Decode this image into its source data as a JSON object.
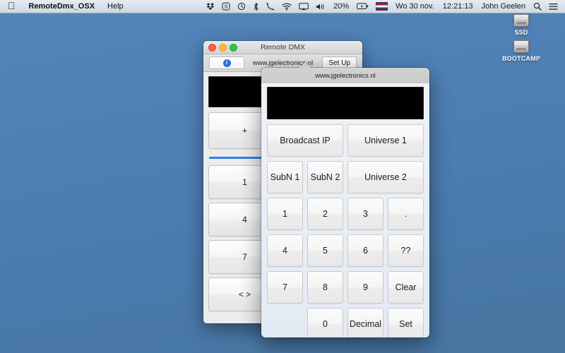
{
  "menubar": {
    "apple_icon": "apple-logo-icon",
    "app_name": "RemoteDmx_OSX",
    "menus": [
      "Help"
    ],
    "status_icons": [
      {
        "name": "dropbox-icon",
        "label": ""
      },
      {
        "name": "circled-s-icon",
        "label": ""
      },
      {
        "name": "clock-icon",
        "label": ""
      },
      {
        "name": "bluetooth-icon",
        "label": ""
      },
      {
        "name": "telephone-handset-icon",
        "label": ""
      },
      {
        "name": "wifi-icon",
        "label": ""
      },
      {
        "name": "airplay-display-icon",
        "label": ""
      },
      {
        "name": "volume-icon",
        "label": ""
      }
    ],
    "battery_percent": "20%",
    "battery_icon": "battery-charging-icon",
    "flag": "netherlands-flag-icon",
    "date": "Wo 30 nov.",
    "time": "12:21:13",
    "user": "John Geelen",
    "search_icon": "search-icon",
    "notification_icon": "notification-center-icon"
  },
  "desktop": {
    "icons": [
      {
        "label": "SSD",
        "glyph": "hard-drive-icon"
      },
      {
        "label": "BOOTCAMP",
        "glyph": "hard-drive-icon"
      }
    ]
  },
  "remote_dmx_window": {
    "title": "Remote DMX",
    "traffic_lights": [
      "close",
      "minimize",
      "maximize"
    ],
    "info_button": "i",
    "url": "www.jgelectronics.nl",
    "setup_button": "Set Up",
    "display_value": "",
    "top_buttons": [
      "+",
      ""
    ],
    "keypad_buttons": [
      "1",
      "",
      "4",
      "",
      "7",
      "",
      "< >",
      ""
    ]
  },
  "setup_panel": {
    "title": "www.jgelectronics.nl",
    "display_value": "",
    "buttons": [
      {
        "label": "Broadcast IP",
        "wide": true
      },
      {
        "label": "Universe 1",
        "wide": true
      },
      {
        "label": "SubN 1",
        "wide": false
      },
      {
        "label": "SubN 2",
        "wide": false
      },
      {
        "label": "Universe 2",
        "wide": true
      },
      {
        "label": "1",
        "wide": false
      },
      {
        "label": "2",
        "wide": false
      },
      {
        "label": "3",
        "wide": false
      },
      {
        "label": ".",
        "wide": false
      },
      {
        "label": "4",
        "wide": false
      },
      {
        "label": "5",
        "wide": false
      },
      {
        "label": "6",
        "wide": false
      },
      {
        "label": "??",
        "wide": false
      },
      {
        "label": "7",
        "wide": false
      },
      {
        "label": "8",
        "wide": false
      },
      {
        "label": "9",
        "wide": false
      },
      {
        "label": "Clear",
        "wide": false
      },
      {
        "label": "",
        "wide": false,
        "empty": true
      },
      {
        "label": "0",
        "wide": false
      },
      {
        "label": "Decimal",
        "wide": false
      },
      {
        "label": "Set",
        "wide": false
      }
    ]
  },
  "colors": {
    "desktop": "#4d7fb5",
    "accent_blue": "#2f7fe8",
    "display_black": "#000000"
  }
}
